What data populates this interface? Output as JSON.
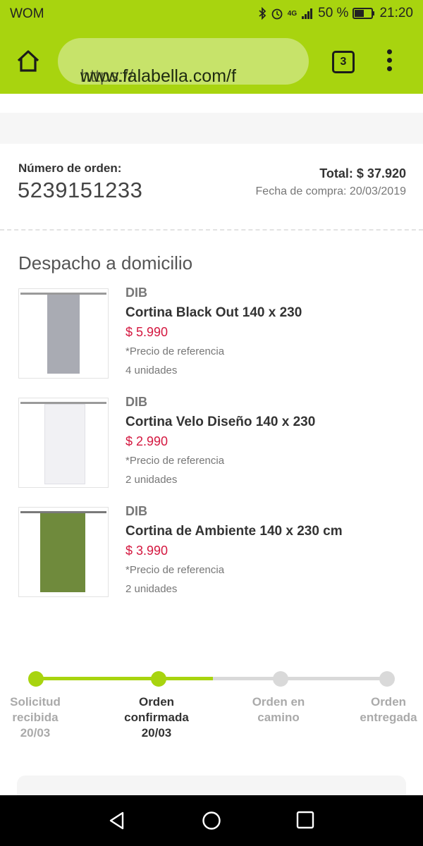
{
  "status_bar": {
    "carrier": "WOM",
    "network": "4G",
    "battery": "50 %",
    "time": "21:20"
  },
  "browser": {
    "url_scheme": "https://",
    "url_host": "www.falabella.com/f",
    "tab_count": "3",
    "icons": [
      "home-icon",
      "tabs-icon",
      "menu-icon"
    ]
  },
  "order": {
    "number_label": "Número de orden:",
    "number": "5239151233",
    "total": "Total: $ 37.920",
    "purchase_date": "Fecha de compra: 20/03/2019"
  },
  "delivery": {
    "title": "Despacho a domicilio",
    "products": [
      {
        "brand": "DIB",
        "name": "Cortina Black Out 140 x 230",
        "price": "$ 5.990",
        "note": "*Precio de referencia",
        "quantity": "4 unidades",
        "curtain_color": "#a9abb3"
      },
      {
        "brand": "DIB",
        "name": "Cortina Velo Diseño 140 x 230",
        "price": "$ 2.990",
        "note": "*Precio de referencia",
        "quantity": "2 unidades",
        "curtain_color": "#f1f1f4"
      },
      {
        "brand": "DIB",
        "name": "Cortina de Ambiente 140 x 230 cm",
        "price": "$ 3.990",
        "note": "*Precio de referencia",
        "quantity": "2 unidades",
        "curtain_color": "#6f8a3c"
      }
    ]
  },
  "tracking": {
    "steps": [
      {
        "label_1": "Solicitud",
        "label_2": "recibida",
        "date": "20/03",
        "state": "done"
      },
      {
        "label_1": "Orden",
        "label_2": "confirmada",
        "date": "20/03",
        "state": "current"
      },
      {
        "label_1": "Orden en",
        "label_2": "camino",
        "date": "",
        "state": "pending"
      },
      {
        "label_1": "Orden",
        "label_2": "entregada",
        "date": "",
        "state": "pending"
      }
    ]
  },
  "colors": {
    "brand_green": "#a8d40f",
    "price_red": "#d4173f",
    "inactive_grey": "#d9d9d9"
  },
  "android_nav": [
    "back-icon",
    "home-circle-icon",
    "recents-icon"
  ]
}
